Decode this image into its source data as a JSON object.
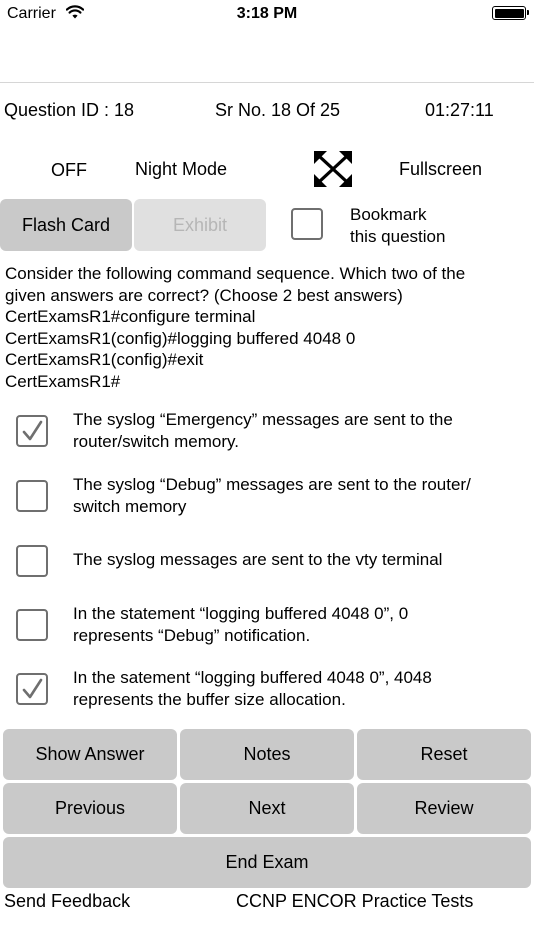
{
  "status_bar": {
    "carrier": "Carrier",
    "time": "3:18 PM"
  },
  "info": {
    "question_id": "Question ID : 18",
    "serial": "Sr No. 18 Of 25",
    "timer": "01:27:11"
  },
  "modes": {
    "night_state": "OFF",
    "night_label": "Night Mode",
    "fullscreen_label": "Fullscreen"
  },
  "actions": {
    "flash_card": "Flash Card",
    "exhibit": "Exhibit",
    "bookmark_line1": "Bookmark",
    "bookmark_line2": "this question",
    "bookmark_checked": false
  },
  "question": {
    "lines": [
      "Consider the following command sequence. Which two of the",
      "given answers are correct? (Choose 2 best answers)",
      "CertExamsR1#configure terminal",
      "CertExamsR1(config)#logging buffered 4048 0",
      "CertExamsR1(config)#exit",
      "CertExamsR1#"
    ]
  },
  "options": [
    {
      "lines": [
        "The syslog “Emergency” messages are sent to the",
        "router/switch memory."
      ],
      "checked": true
    },
    {
      "lines": [
        "The syslog “Debug” messages are sent to the router/",
        "switch memory"
      ],
      "checked": false
    },
    {
      "lines": [
        "The syslog messages are sent to the vty terminal"
      ],
      "checked": false
    },
    {
      "lines": [
        "In the statement “logging buffered 4048 0”, 0",
        "represents “Debug” notification."
      ],
      "checked": false
    },
    {
      "lines": [
        "In the satement “logging buffered 4048 0”, 4048",
        "represents the buffer size allocation."
      ],
      "checked": true
    }
  ],
  "buttons": {
    "show_answer": "Show Answer",
    "notes": "Notes",
    "reset": "Reset",
    "previous": "Previous",
    "next": "Next",
    "review": "Review",
    "end_exam": "End Exam"
  },
  "footer": {
    "send_feedback": "Send Feedback",
    "app_name": "CCNP ENCOR Practice Tests"
  },
  "icons": {
    "wifi": "wifi-icon",
    "battery": "battery-icon",
    "fullscreen": "fullscreen-icon",
    "checkmark": "checkmark-icon"
  }
}
